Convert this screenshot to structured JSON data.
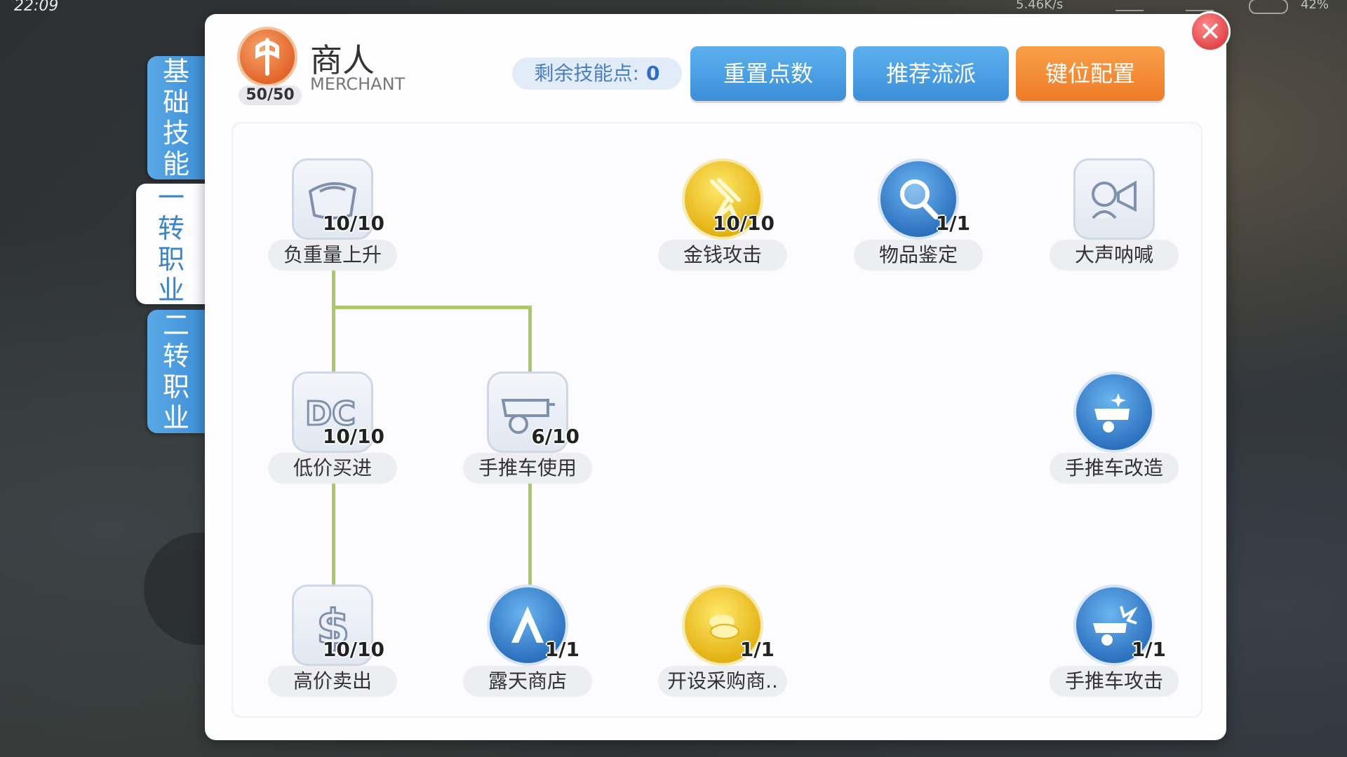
{
  "status_bar": {
    "time": "22:09",
    "net_speed": "5.46K/s",
    "battery": "42%"
  },
  "side_tabs": [
    {
      "label": "基础技能",
      "active": false
    },
    {
      "label": "一转职业",
      "active": true
    },
    {
      "label": "二转职业",
      "active": false
    }
  ],
  "class_info": {
    "name": "商人",
    "english": "MERCHANT",
    "level": "50/50"
  },
  "header": {
    "points_label": "剩余技能点:",
    "points_value": "0",
    "reset_label": "重置点数",
    "recommend_label": "推荐流派",
    "keybind_label": "键位配置"
  },
  "colors": {
    "accent_blue": "#3f8fd6",
    "accent_orange": "#ef7a26",
    "connector": "#a9c96a",
    "close_red": "#e0464a"
  },
  "skills": [
    {
      "name": "负重量上升",
      "level": "10/10",
      "icon": "bag-icon"
    },
    {
      "name": "金钱攻击",
      "level": "10/10",
      "icon": "gold-strike-icon"
    },
    {
      "name": "物品鉴定",
      "level": "1/1",
      "icon": "magnifier-icon"
    },
    {
      "name": "大声呐喊",
      "level": "",
      "icon": "shout-icon"
    },
    {
      "name": "低价买进",
      "level": "10/10",
      "icon": "discount-icon"
    },
    {
      "name": "手推车使用",
      "level": "6/10",
      "icon": "cart-icon"
    },
    {
      "name": "手推车改造",
      "level": "",
      "icon": "cart-upgrade-icon"
    },
    {
      "name": "高价卖出",
      "level": "10/10",
      "icon": "dollar-icon"
    },
    {
      "name": "露天商店",
      "level": "1/1",
      "icon": "stall-icon"
    },
    {
      "name": "开设采购商..",
      "level": "1/1",
      "icon": "coins-icon"
    },
    {
      "name": "手推车攻击",
      "level": "1/1",
      "icon": "cart-attack-icon"
    }
  ]
}
